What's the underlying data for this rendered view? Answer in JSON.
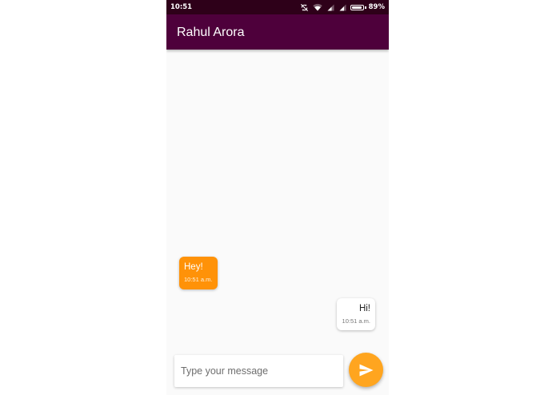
{
  "status_bar": {
    "time": "10:51",
    "battery_percent": "89%",
    "battery_level": 0.89,
    "icons": [
      "sync-disabled-icon",
      "wifi-icon",
      "signal-icon",
      "signal-icon",
      "battery-icon"
    ]
  },
  "app_bar": {
    "title": "Rahul Arora",
    "color": "#4e003b"
  },
  "messages": [
    {
      "direction": "incoming",
      "text": "Hey!",
      "time": "10:51 a.m.",
      "color": "#ff9208"
    },
    {
      "direction": "outgoing",
      "text": "Hi!",
      "time": "10:51 a.m.",
      "color": "#ffffff"
    }
  ],
  "composer": {
    "placeholder": "Type your message",
    "value": "",
    "send_icon": "send-icon",
    "send_color": "#ffa51f"
  }
}
